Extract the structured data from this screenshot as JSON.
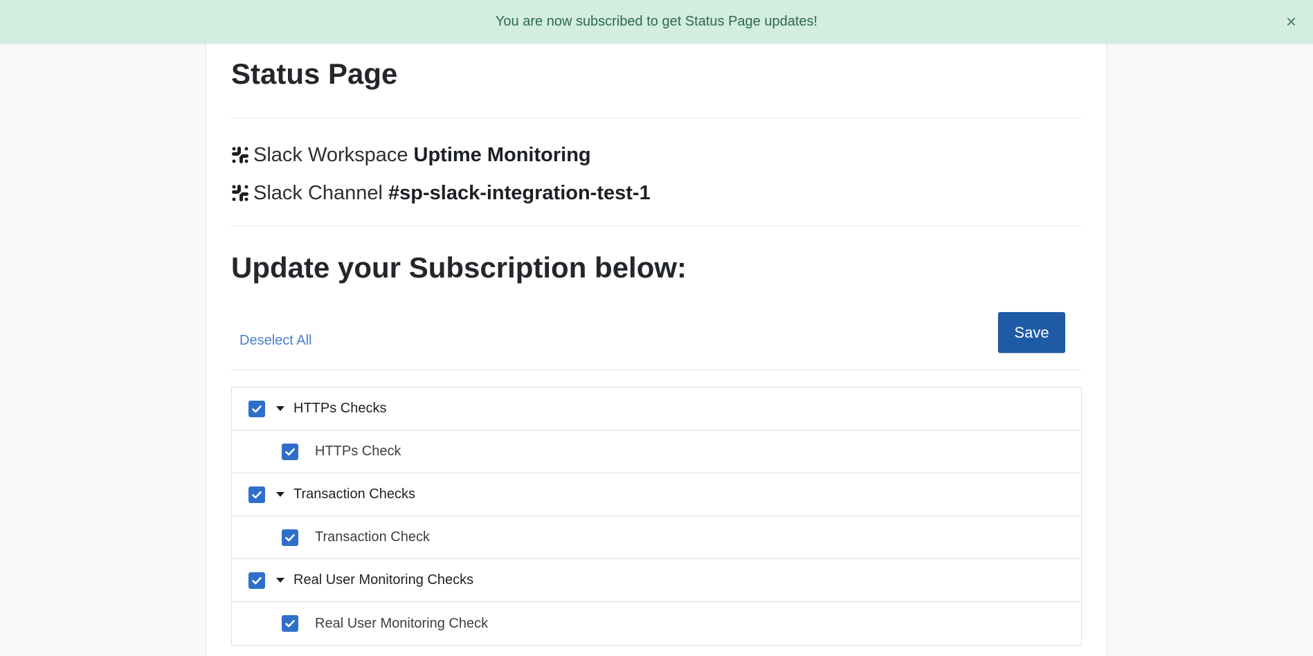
{
  "banner": {
    "message": "You are now subscribed to get Status Page updates!",
    "close_glyph": "×"
  },
  "page": {
    "title": "Status Page"
  },
  "slack": {
    "workspace_label": "Slack Workspace",
    "workspace_value": "Uptime Monitoring",
    "channel_label": "Slack Channel",
    "channel_value": "#sp-slack-integration-test-1",
    "icon": "slack-icon"
  },
  "subscription": {
    "heading": "Update your Subscription below:",
    "deselect_label": "Deselect All",
    "save_label": "Save",
    "groups": [
      {
        "label": "HTTPs Checks",
        "checked": true,
        "children": [
          {
            "label": "HTTPs Check",
            "checked": true
          }
        ]
      },
      {
        "label": "Transaction Checks",
        "checked": true,
        "children": [
          {
            "label": "Transaction Check",
            "checked": true
          }
        ]
      },
      {
        "label": "Real User Monitoring Checks",
        "checked": true,
        "children": [
          {
            "label": "Real User Monitoring Check",
            "checked": true
          }
        ]
      }
    ]
  },
  "colors": {
    "banner_bg": "#d3ede0",
    "banner_text": "#2d6a4a",
    "primary": "#1e5aa6",
    "checkbox": "#2f6fcb",
    "link": "#4a80c8"
  }
}
